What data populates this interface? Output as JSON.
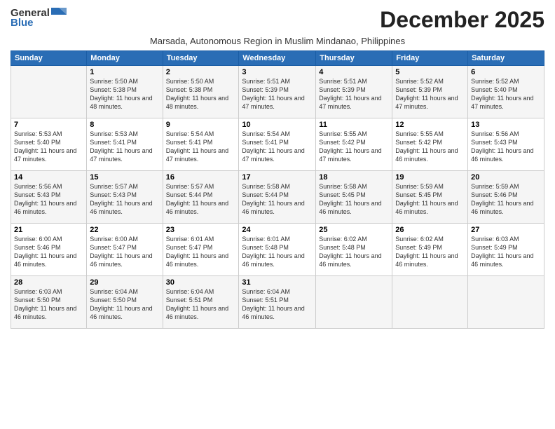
{
  "logo": {
    "general": "General",
    "blue": "Blue"
  },
  "title": "December 2025",
  "subtitle": "Marsada, Autonomous Region in Muslim Mindanao, Philippines",
  "days_header": [
    "Sunday",
    "Monday",
    "Tuesday",
    "Wednesday",
    "Thursday",
    "Friday",
    "Saturday"
  ],
  "weeks": [
    [
      {
        "day": "",
        "info": ""
      },
      {
        "day": "1",
        "info": "Sunrise: 5:50 AM\nSunset: 5:38 PM\nDaylight: 11 hours\nand 48 minutes."
      },
      {
        "day": "2",
        "info": "Sunrise: 5:50 AM\nSunset: 5:38 PM\nDaylight: 11 hours\nand 48 minutes."
      },
      {
        "day": "3",
        "info": "Sunrise: 5:51 AM\nSunset: 5:39 PM\nDaylight: 11 hours\nand 47 minutes."
      },
      {
        "day": "4",
        "info": "Sunrise: 5:51 AM\nSunset: 5:39 PM\nDaylight: 11 hours\nand 47 minutes."
      },
      {
        "day": "5",
        "info": "Sunrise: 5:52 AM\nSunset: 5:39 PM\nDaylight: 11 hours\nand 47 minutes."
      },
      {
        "day": "6",
        "info": "Sunrise: 5:52 AM\nSunset: 5:40 PM\nDaylight: 11 hours\nand 47 minutes."
      }
    ],
    [
      {
        "day": "7",
        "info": "Sunrise: 5:53 AM\nSunset: 5:40 PM\nDaylight: 11 hours\nand 47 minutes."
      },
      {
        "day": "8",
        "info": "Sunrise: 5:53 AM\nSunset: 5:41 PM\nDaylight: 11 hours\nand 47 minutes."
      },
      {
        "day": "9",
        "info": "Sunrise: 5:54 AM\nSunset: 5:41 PM\nDaylight: 11 hours\nand 47 minutes."
      },
      {
        "day": "10",
        "info": "Sunrise: 5:54 AM\nSunset: 5:41 PM\nDaylight: 11 hours\nand 47 minutes."
      },
      {
        "day": "11",
        "info": "Sunrise: 5:55 AM\nSunset: 5:42 PM\nDaylight: 11 hours\nand 47 minutes."
      },
      {
        "day": "12",
        "info": "Sunrise: 5:55 AM\nSunset: 5:42 PM\nDaylight: 11 hours\nand 46 minutes."
      },
      {
        "day": "13",
        "info": "Sunrise: 5:56 AM\nSunset: 5:43 PM\nDaylight: 11 hours\nand 46 minutes."
      }
    ],
    [
      {
        "day": "14",
        "info": "Sunrise: 5:56 AM\nSunset: 5:43 PM\nDaylight: 11 hours\nand 46 minutes."
      },
      {
        "day": "15",
        "info": "Sunrise: 5:57 AM\nSunset: 5:43 PM\nDaylight: 11 hours\nand 46 minutes."
      },
      {
        "day": "16",
        "info": "Sunrise: 5:57 AM\nSunset: 5:44 PM\nDaylight: 11 hours\nand 46 minutes."
      },
      {
        "day": "17",
        "info": "Sunrise: 5:58 AM\nSunset: 5:44 PM\nDaylight: 11 hours\nand 46 minutes."
      },
      {
        "day": "18",
        "info": "Sunrise: 5:58 AM\nSunset: 5:45 PM\nDaylight: 11 hours\nand 46 minutes."
      },
      {
        "day": "19",
        "info": "Sunrise: 5:59 AM\nSunset: 5:45 PM\nDaylight: 11 hours\nand 46 minutes."
      },
      {
        "day": "20",
        "info": "Sunrise: 5:59 AM\nSunset: 5:46 PM\nDaylight: 11 hours\nand 46 minutes."
      }
    ],
    [
      {
        "day": "21",
        "info": "Sunrise: 6:00 AM\nSunset: 5:46 PM\nDaylight: 11 hours\nand 46 minutes."
      },
      {
        "day": "22",
        "info": "Sunrise: 6:00 AM\nSunset: 5:47 PM\nDaylight: 11 hours\nand 46 minutes."
      },
      {
        "day": "23",
        "info": "Sunrise: 6:01 AM\nSunset: 5:47 PM\nDaylight: 11 hours\nand 46 minutes."
      },
      {
        "day": "24",
        "info": "Sunrise: 6:01 AM\nSunset: 5:48 PM\nDaylight: 11 hours\nand 46 minutes."
      },
      {
        "day": "25",
        "info": "Sunrise: 6:02 AM\nSunset: 5:48 PM\nDaylight: 11 hours\nand 46 minutes."
      },
      {
        "day": "26",
        "info": "Sunrise: 6:02 AM\nSunset: 5:49 PM\nDaylight: 11 hours\nand 46 minutes."
      },
      {
        "day": "27",
        "info": "Sunrise: 6:03 AM\nSunset: 5:49 PM\nDaylight: 11 hours\nand 46 minutes."
      }
    ],
    [
      {
        "day": "28",
        "info": "Sunrise: 6:03 AM\nSunset: 5:50 PM\nDaylight: 11 hours\nand 46 minutes."
      },
      {
        "day": "29",
        "info": "Sunrise: 6:04 AM\nSunset: 5:50 PM\nDaylight: 11 hours\nand 46 minutes."
      },
      {
        "day": "30",
        "info": "Sunrise: 6:04 AM\nSunset: 5:51 PM\nDaylight: 11 hours\nand 46 minutes."
      },
      {
        "day": "31",
        "info": "Sunrise: 6:04 AM\nSunset: 5:51 PM\nDaylight: 11 hours\nand 46 minutes."
      },
      {
        "day": "",
        "info": ""
      },
      {
        "day": "",
        "info": ""
      },
      {
        "day": "",
        "info": ""
      }
    ]
  ]
}
